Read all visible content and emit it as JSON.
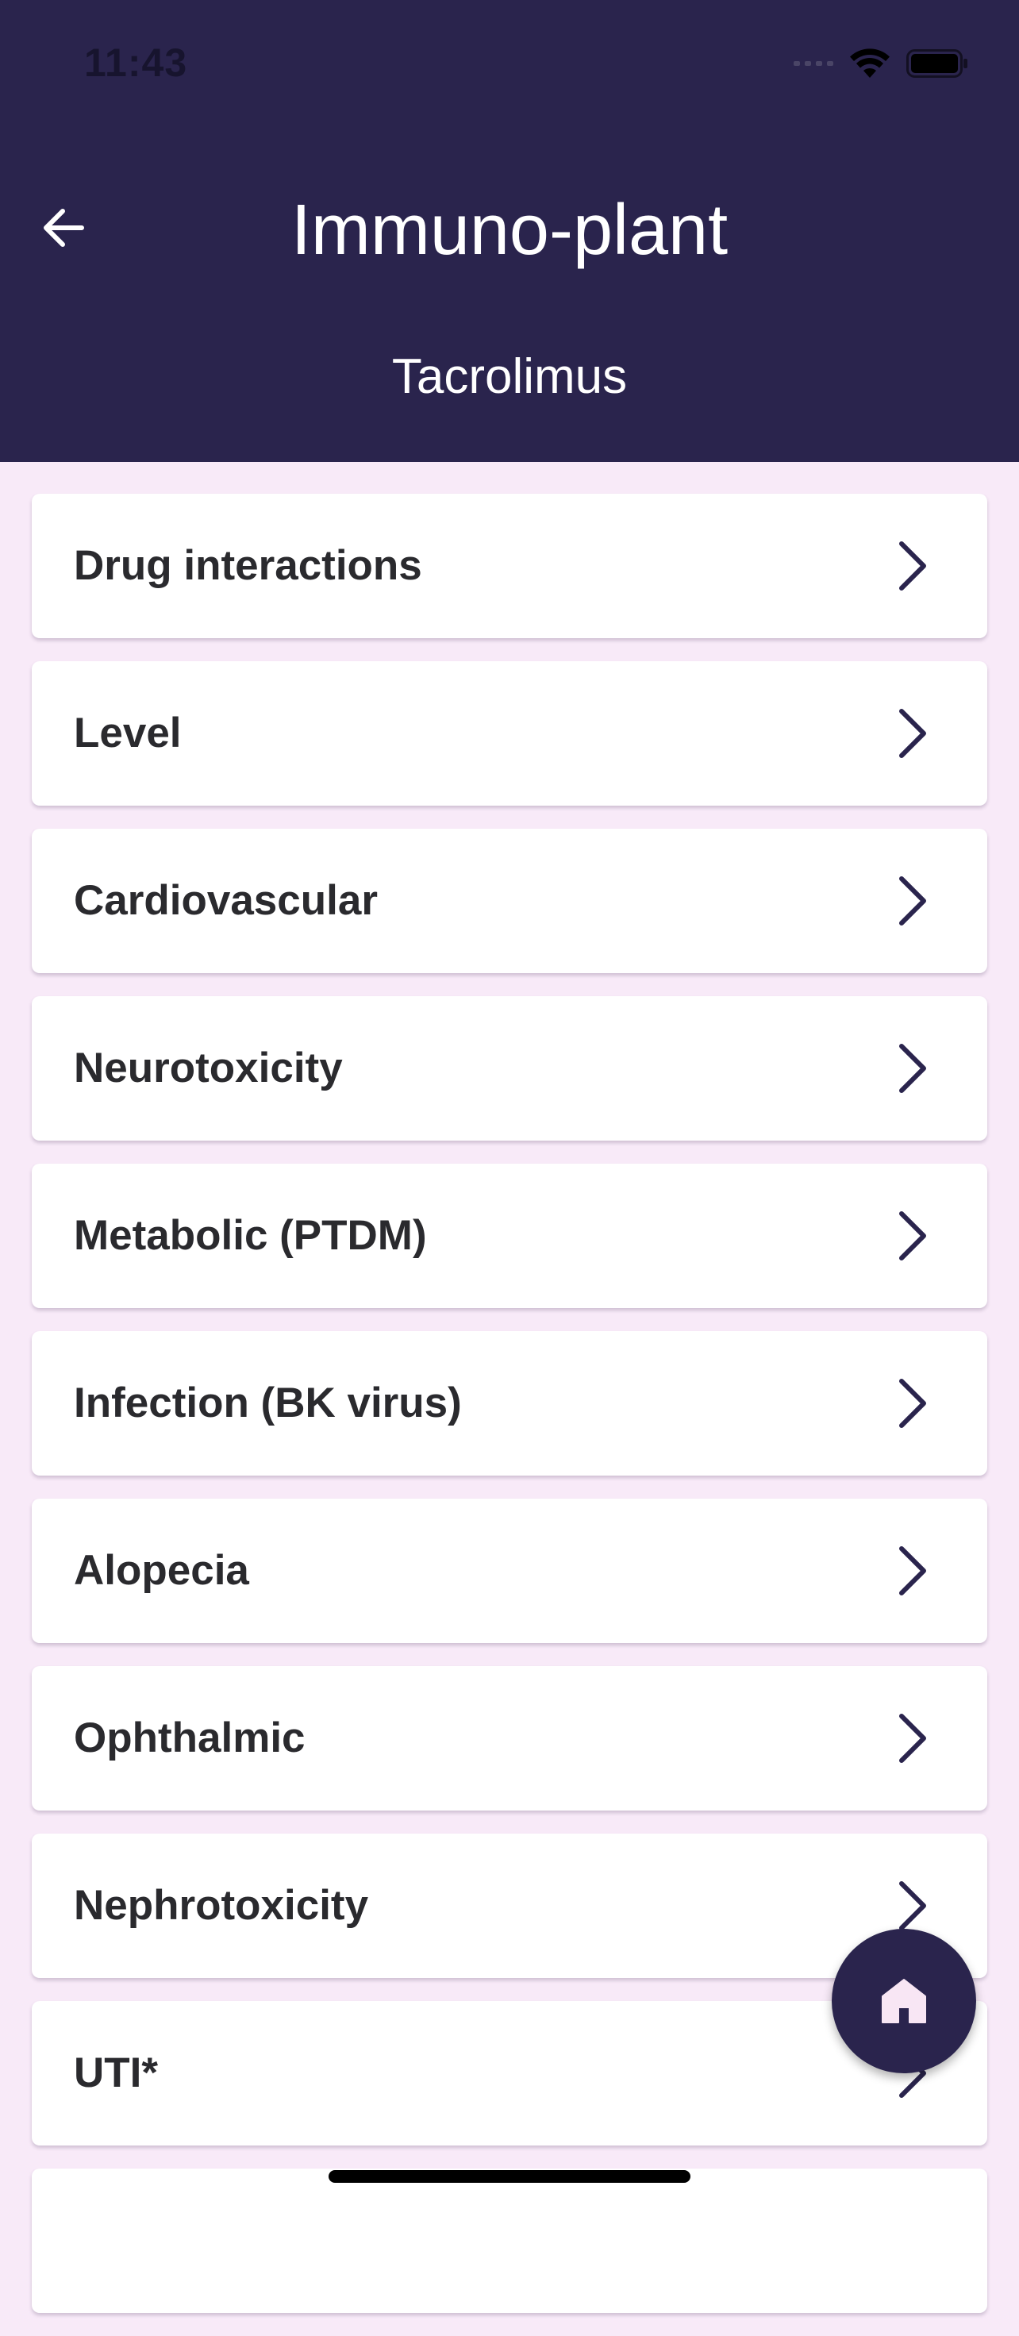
{
  "status_bar": {
    "time": "11:43"
  },
  "header": {
    "title": "Immuno-plant",
    "subtitle": "Tacrolimus",
    "back_icon": "arrow-left-icon"
  },
  "menu": {
    "items": [
      {
        "label": "Drug interactions"
      },
      {
        "label": "Level"
      },
      {
        "label": "Cardiovascular"
      },
      {
        "label": "Neurotoxicity"
      },
      {
        "label": "Metabolic (PTDM)"
      },
      {
        "label": "Infection (BK virus)"
      },
      {
        "label": "Alopecia"
      },
      {
        "label": "Ophthalmic"
      },
      {
        "label": "Nephrotoxicity"
      },
      {
        "label": "UTI*"
      },
      {
        "label": ""
      }
    ],
    "chevron_icon": "chevron-right-icon"
  },
  "fab": {
    "icon": "home-icon"
  },
  "colors": {
    "header_bg": "#2a244d",
    "page_bg": "#f8eaf8",
    "card_bg": "#ffffff",
    "accent": "#2a244d",
    "fab_icon": "#f8e6f4"
  }
}
